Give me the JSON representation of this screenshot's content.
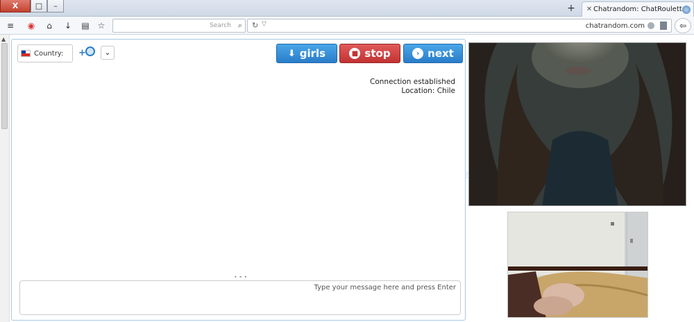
{
  "browser": {
    "tab_title": "Chatrandom: ChatRoulette...",
    "tab_close": "✕",
    "new_tab": "+",
    "url": "chatrandom.com",
    "search_placeholder": "Search",
    "window_controls": {
      "close": "X",
      "maximize": "□",
      "minimize": "–"
    },
    "nav_icons": [
      "menu-icon",
      "extension-icon",
      "home-icon",
      "download-icon",
      "reader-icon",
      "bookmark-star-icon",
      "search-icon",
      "reload-icon",
      "back-icon"
    ]
  },
  "chat": {
    "buttons": {
      "next": "next",
      "stop": "stop",
      "girls": "girls"
    },
    "country_label": "Country:",
    "country_flag": "Chile",
    "status_lines": [
      "Connection established",
      "Location: Chile"
    ],
    "message_placeholder": "Type your message here and press Enter"
  },
  "colors": {
    "next_button": "#2a7dc9",
    "stop_button": "#c23333",
    "girls_button": "#2a7dc9",
    "panel_border": "#a8c8e0"
  }
}
